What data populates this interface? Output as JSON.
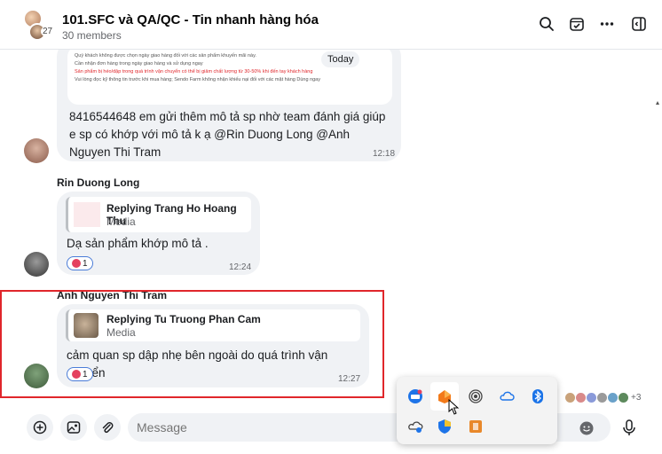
{
  "header": {
    "title": "101.SFC và QA/QC - Tin nhanh hàng hóa",
    "members": "30 members",
    "avatar_count": "27"
  },
  "messages": {
    "first": {
      "image_lines": [
        "Quý khách không được chọn ngày giao hàng đối với các sản phẩm khuyến mãi này.",
        "Cần nhận đơn hàng trong ngày giao hàng và sử dụng ngay",
        "Sản phẩm bị héo/dập trong quá trình vận chuyển có thể bị giảm chất lượng từ 30-50% khi đến tay khách hàng",
        "Vui lòng đọc kỹ thông tin trước khi mua hàng; Sendo Farm không nhận khiếu nại đối với các mặt hàng Dùng ngay"
      ],
      "today_badge": "Today",
      "text": "8416544648  em gửi thêm mô tả sp nhờ team đánh giá giúp e sp có khớp với mô tả  k ạ @Rin Duong Long @Anh Nguyen Thi Tram",
      "time": "12:18"
    },
    "second": {
      "sender": "Rin Duong Long",
      "reply_title": "Replying Trang Ho Hoang Thu",
      "reply_sub": "Media",
      "text": "Dạ sản phẩm khớp mô tả .",
      "reaction_count": "1",
      "time": "12:24"
    },
    "third": {
      "sender": "Anh Nguyen Thi Tram",
      "reply_title": "Replying Tu Truong Phan Cam",
      "reply_sub": "Media",
      "text": "cảm quan sp dập nhẹ bên ngoài do quá trình vận chuyển",
      "reaction_count": "1",
      "time": "12:27"
    }
  },
  "seen_by": {
    "extra": "+3"
  },
  "composer": {
    "placeholder": "Message"
  },
  "colors": {
    "highlight": "#e0262b",
    "heart": "#e4405f",
    "reaction_border": "#4a7cd8"
  },
  "icons": {
    "header": [
      "search-icon",
      "calendar-check-icon",
      "more-icon",
      "sidebar-toggle-icon"
    ],
    "composer": [
      "add-icon",
      "image-icon",
      "attachment-icon",
      "emoji-icon",
      "microphone-icon"
    ],
    "tray": [
      "zalo-icon",
      "app-orange-icon",
      "fingerprint-icon",
      "onedrive-icon",
      "bluetooth-icon",
      "network-cloud-icon",
      "defender-icon",
      "app-box-icon"
    ]
  }
}
